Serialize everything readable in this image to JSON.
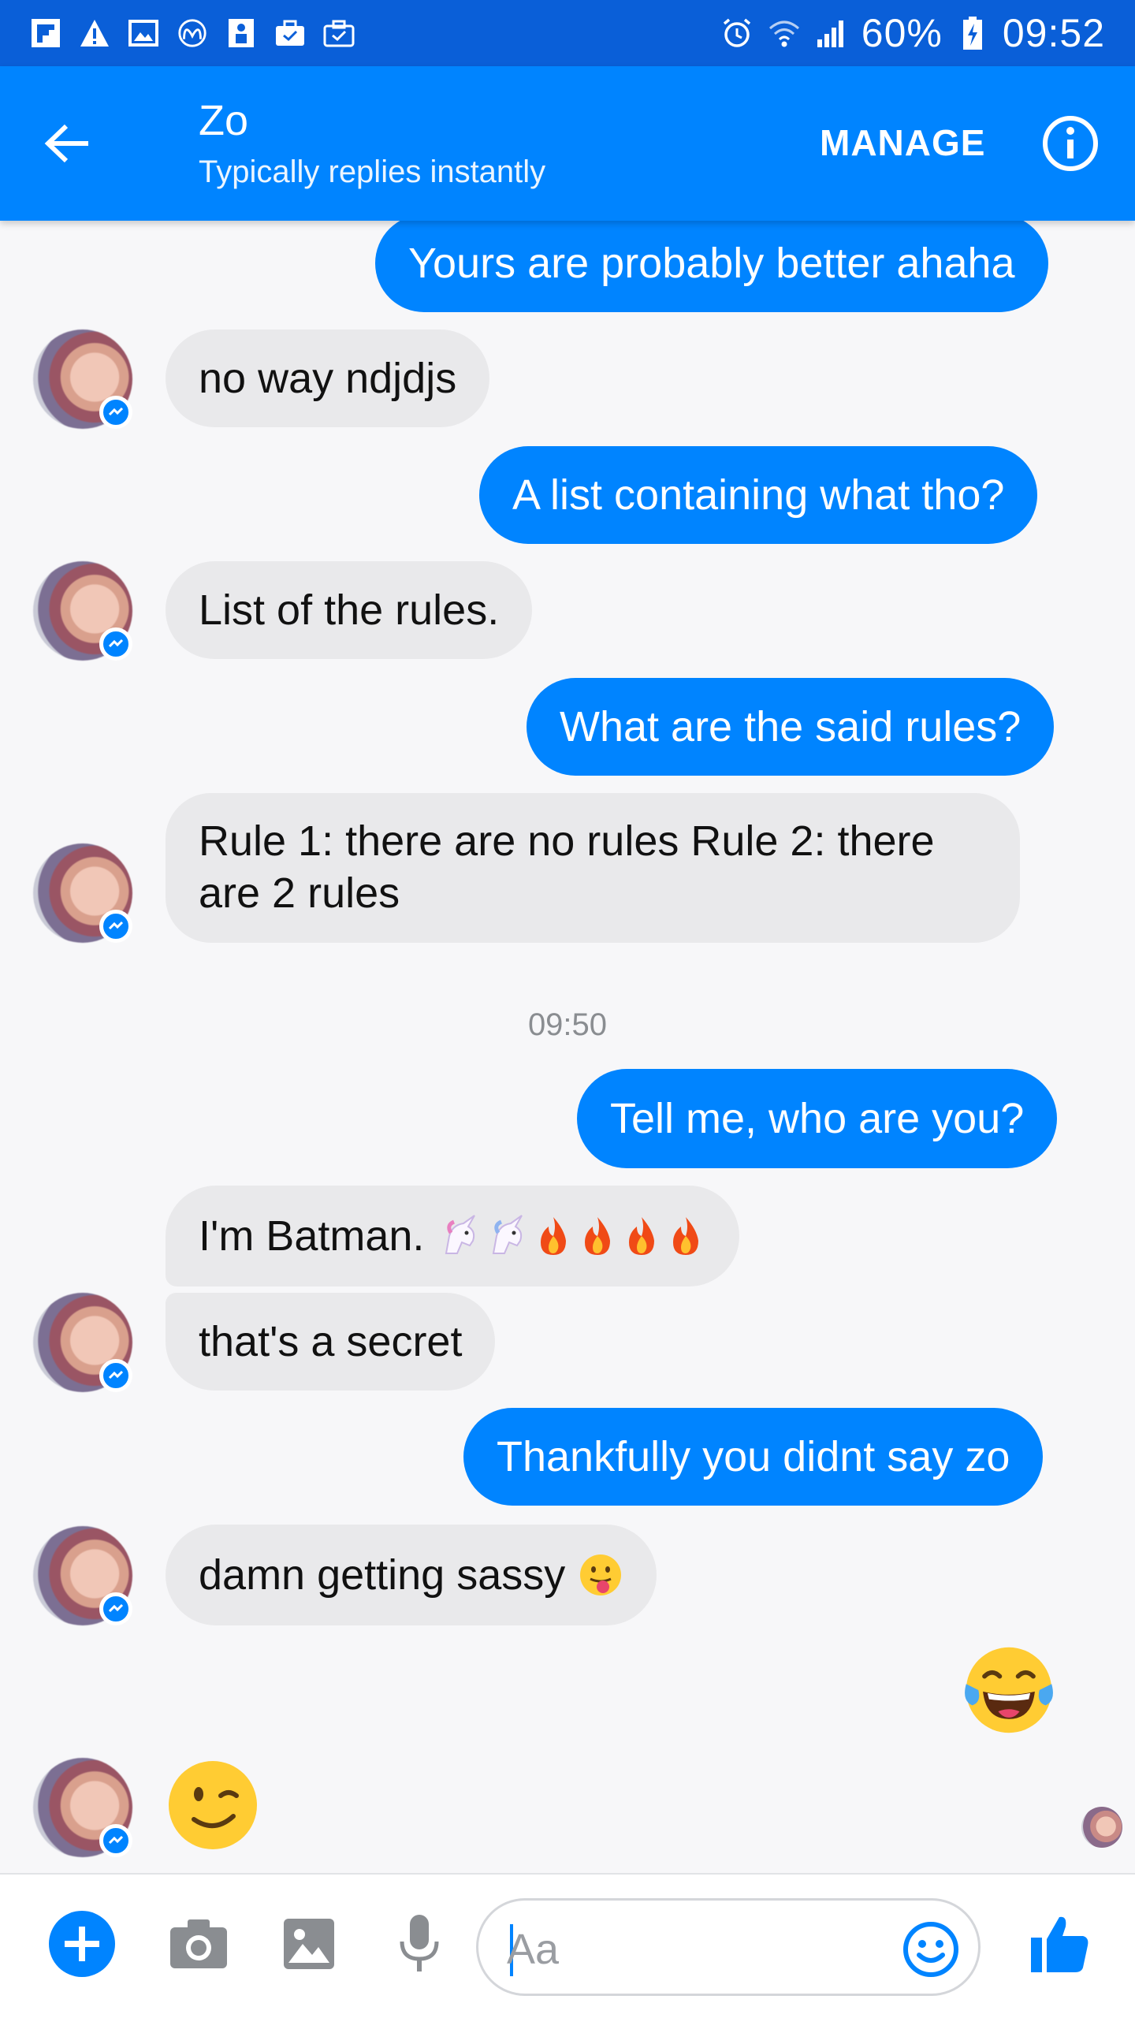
{
  "status_bar": {
    "battery_percent": "60%",
    "time": "09:52",
    "left_icons": [
      "flipboard-icon",
      "warning-icon",
      "gallery-icon",
      "mcdonalds-icon",
      "user-badge-icon",
      "briefcase-icon",
      "briefcase-check-icon"
    ],
    "right_icons": [
      "alarm-icon",
      "wifi-icon",
      "signal-icon",
      "battery-charging-icon"
    ]
  },
  "header": {
    "contact_name": "Zo",
    "subtitle": "Typically replies instantly",
    "manage_label": "MANAGE"
  },
  "messages": [
    {
      "sender": "me",
      "text": "Yours are probably better ahaha"
    },
    {
      "sender": "zo",
      "text": "no way ndjdjs"
    },
    {
      "sender": "me",
      "text": "A list containing what tho?"
    },
    {
      "sender": "zo",
      "text": "List of the rules."
    },
    {
      "sender": "me",
      "text": "What are the said rules?"
    },
    {
      "sender": "zo",
      "text": "Rule 1: there are no rules Rule 2: there are 2 rules"
    },
    {
      "sender": "system",
      "text": "09:50"
    },
    {
      "sender": "me",
      "text": "Tell me, who are you?"
    },
    {
      "sender": "zo",
      "text": "I'm Batman.",
      "emojis": [
        "unicorn",
        "unicorn",
        "fire",
        "fire",
        "fire",
        "fire"
      ]
    },
    {
      "sender": "zo",
      "text": "that's a secret"
    },
    {
      "sender": "me",
      "text": "Thankfully you didnt say zo"
    },
    {
      "sender": "zo",
      "text": "damn getting sassy",
      "emojis": [
        "tongue-face"
      ]
    },
    {
      "sender": "me",
      "emoji": "tears-of-joy"
    },
    {
      "sender": "zo",
      "emoji": "winking-face"
    }
  ],
  "composer": {
    "placeholder": "Aa",
    "value": ""
  },
  "colors": {
    "status_bar": "#0a5fd8",
    "header": "#0084ff",
    "outgoing_bubble": "#0084ff",
    "incoming_bubble": "#e9e9eb",
    "background": "#f7f7f9"
  }
}
